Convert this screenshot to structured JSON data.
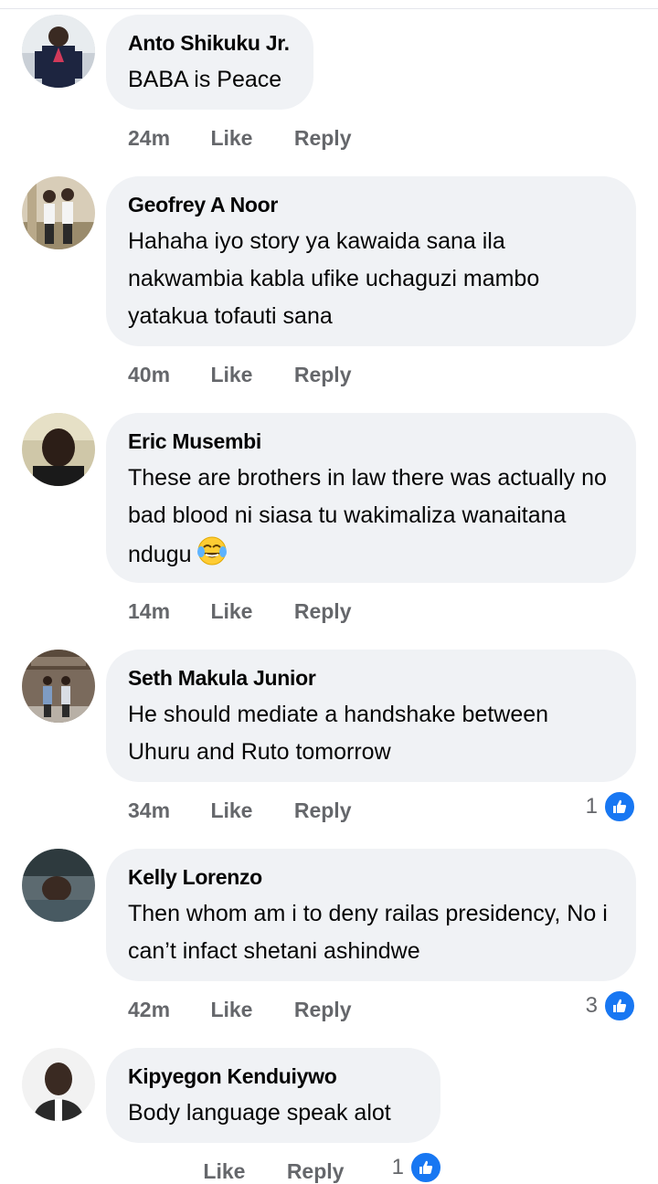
{
  "comments": [
    {
      "author": "Anto Shikuku Jr.",
      "text": "BABA is Peace",
      "time": "24m",
      "like_label": "Like",
      "reply_label": "Reply",
      "avatar_icon": "profile-photo-man-suit"
    },
    {
      "author": "Geofrey A Noor",
      "text": "Hahaha iyo story ya kawaida sana ila nakwambia kabla ufike uchaguzi mambo yatakua tofauti sana",
      "time": "40m",
      "like_label": "Like",
      "reply_label": "Reply",
      "avatar_icon": "profile-photo-two-people"
    },
    {
      "author": "Eric Musembi",
      "text": "These are brothers in law there was actually no bad blood ni siasa tu wakimaliza wanaitana ndugu",
      "emoji": "tears-of-joy-emoji",
      "time": "14m",
      "like_label": "Like",
      "reply_label": "Reply",
      "avatar_icon": "profile-photo-man-selfie"
    },
    {
      "author": "Seth Makula Junior",
      "text": "He should mediate a handshake between Uhuru and Ruto tomorrow",
      "time": "34m",
      "like_label": "Like",
      "reply_label": "Reply",
      "reaction_count": "1",
      "reaction_icon": "like-thumb-icon",
      "avatar_icon": "profile-photo-two-men-building"
    },
    {
      "author": "Kelly Lorenzo",
      "text": "Then whom am i to deny railas presidency, No i can’t infact shetani ashindwe",
      "time": "42m",
      "like_label": "Like",
      "reply_label": "Reply",
      "reaction_count": "3",
      "reaction_icon": "like-thumb-icon",
      "avatar_icon": "profile-photo-man-lying"
    },
    {
      "author": "Kipyegon Kenduiywo",
      "text": "Body language speak alot",
      "time": "",
      "like_label": "Like",
      "reply_label": "Reply",
      "reaction_count": "1",
      "reaction_icon": "like-thumb-icon",
      "avatar_icon": "profile-photo-man-smiling"
    }
  ],
  "colors": {
    "bubble": "#f0f2f5",
    "author": "#050505",
    "meta": "#65676b",
    "like_blue": "#1877f2"
  }
}
